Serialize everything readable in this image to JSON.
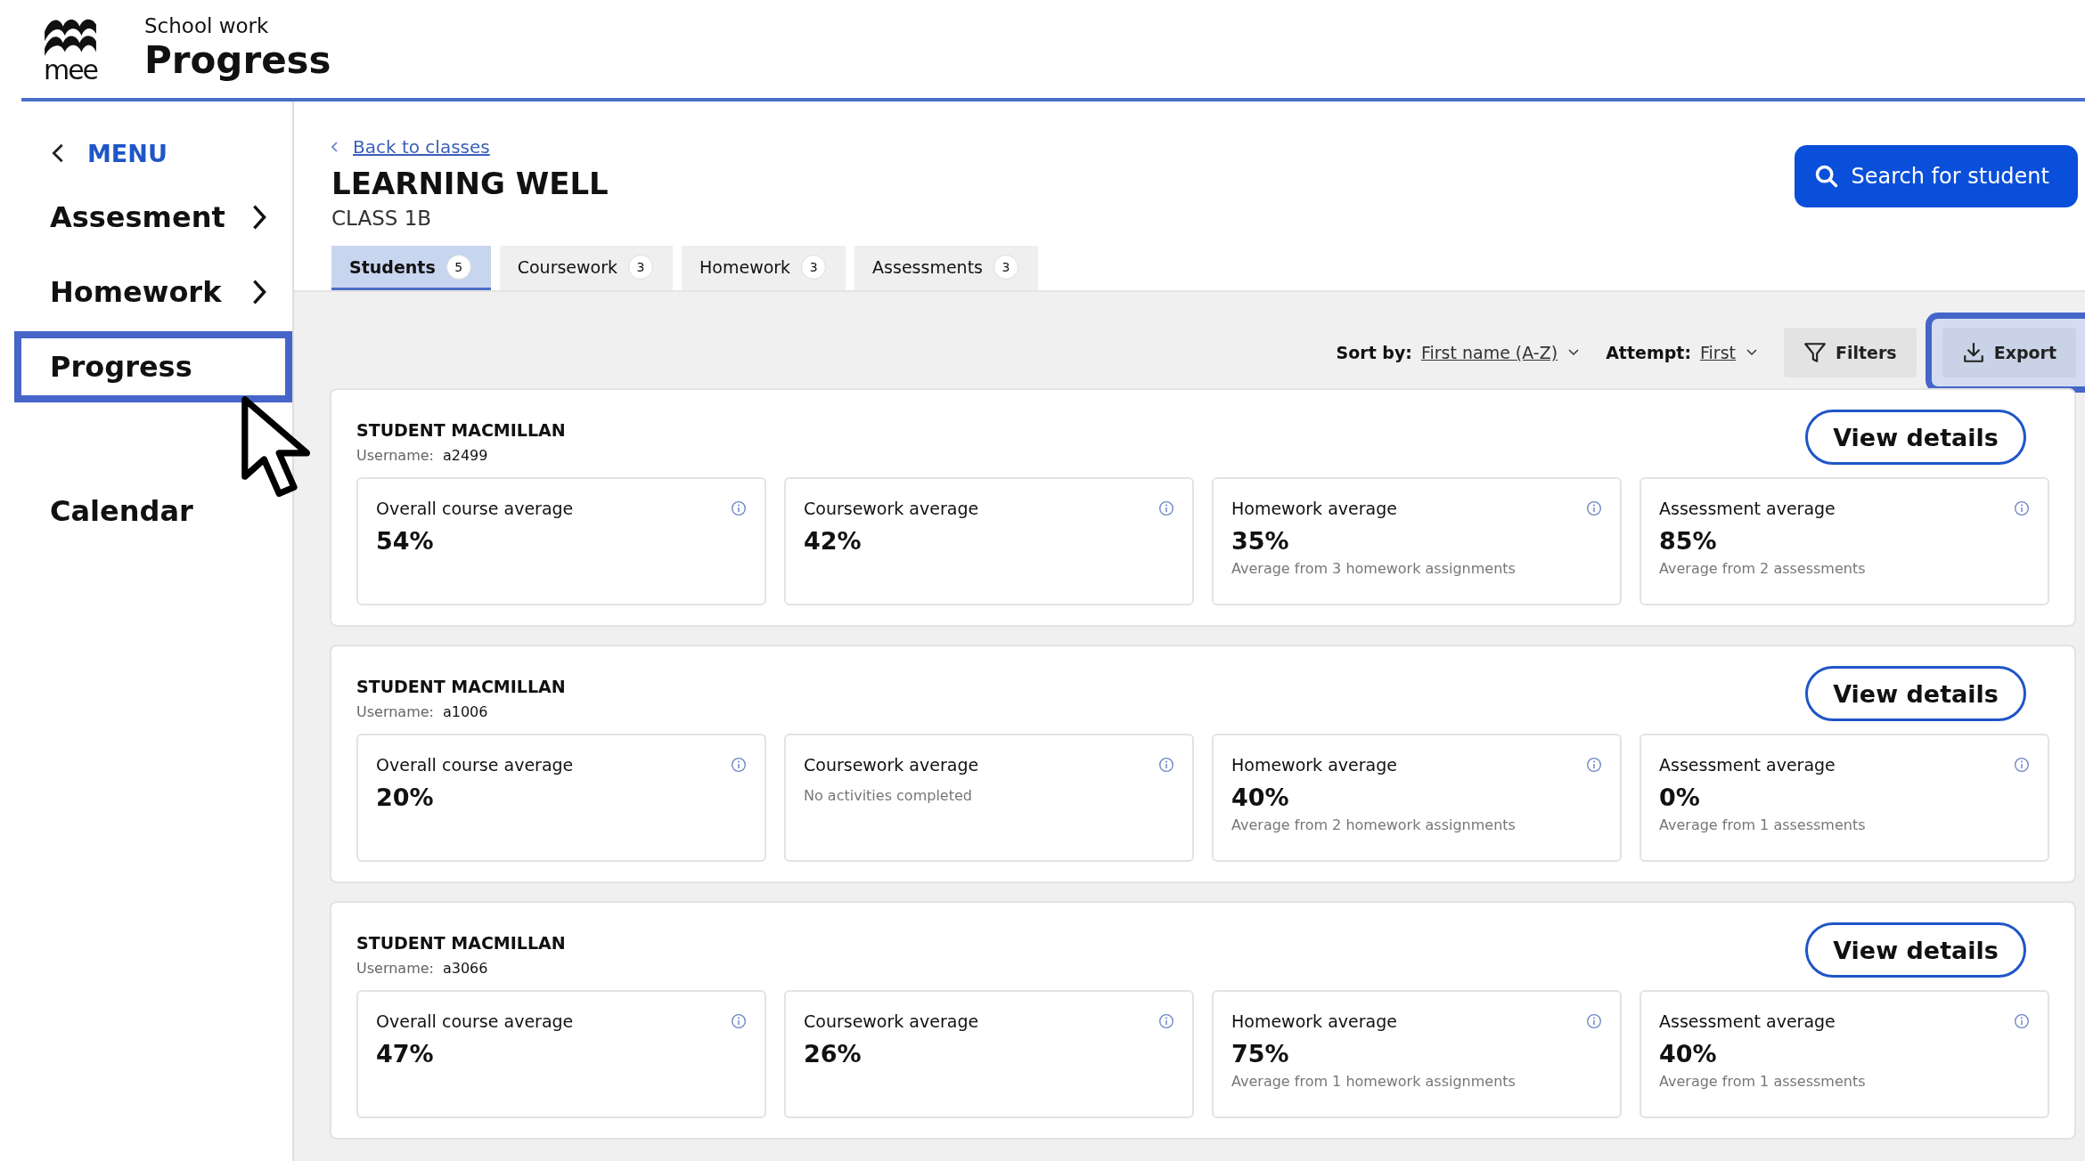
{
  "header": {
    "logo_text": "mee",
    "section": "School work",
    "title": "Progress"
  },
  "sidebar": {
    "menu_label": "MENU",
    "items": [
      {
        "label": "Assesment",
        "has_submenu": true,
        "selected": false
      },
      {
        "label": "Homework",
        "has_submenu": true,
        "selected": false
      },
      {
        "label": "Progress",
        "has_submenu": false,
        "selected": true
      },
      {
        "label": "Calendar",
        "has_submenu": false,
        "selected": false
      }
    ]
  },
  "back_link": "Back to classes",
  "class_name": "LEARNING WELL",
  "class_code": "CLASS 1B",
  "search_button": "Search for student",
  "tabs": [
    {
      "label": "Students",
      "count": "5",
      "selected": true
    },
    {
      "label": "Coursework",
      "count": "3",
      "selected": false
    },
    {
      "label": "Homework",
      "count": "3",
      "selected": false
    },
    {
      "label": "Assessments",
      "count": "3",
      "selected": false
    }
  ],
  "toolbar": {
    "sort_label": "Sort by:",
    "sort_value": "First name (A-Z)",
    "attempt_label": "Attempt:",
    "attempt_value": "First",
    "filters_button": "Filters",
    "export_button": "Export",
    "export_highlighted": true
  },
  "students": [
    {
      "name": "STUDENT MACMILLAN",
      "username_label": "Username:",
      "username": "a2499",
      "button": "View details",
      "stats": [
        {
          "label": "Overall course average",
          "value": "54%"
        },
        {
          "label": "Coursework average",
          "value": "42%"
        },
        {
          "label": "Homework average",
          "value": "35%",
          "note": "Average from 3 homework assignments"
        },
        {
          "label": "Assessment average",
          "value": "85%",
          "note": "Average from 2 assessments"
        }
      ]
    },
    {
      "name": "STUDENT MACMILLAN",
      "username_label": "Username:",
      "username": "a1006",
      "button": "View details",
      "stats": [
        {
          "label": "Overall course average",
          "value": "20%"
        },
        {
          "label": "Coursework average",
          "note": "No activities completed"
        },
        {
          "label": "Homework average",
          "value": "40%",
          "note": "Average from 2 homework assignments"
        },
        {
          "label": "Assessment average",
          "value": "0%",
          "note": "Average from 1 assessments"
        }
      ]
    },
    {
      "name": "STUDENT MACMILLAN",
      "username_label": "Username:",
      "username": "a3066",
      "button": "View details",
      "stats": [
        {
          "label": "Overall course average",
          "value": "47%"
        },
        {
          "label": "Coursework average",
          "value": "26%"
        },
        {
          "label": "Homework average",
          "value": "75%",
          "note": "Average from 1 homework assignments"
        },
        {
          "label": "Assessment average",
          "value": "40%",
          "note": "Average from 1 assessments"
        }
      ]
    }
  ]
}
